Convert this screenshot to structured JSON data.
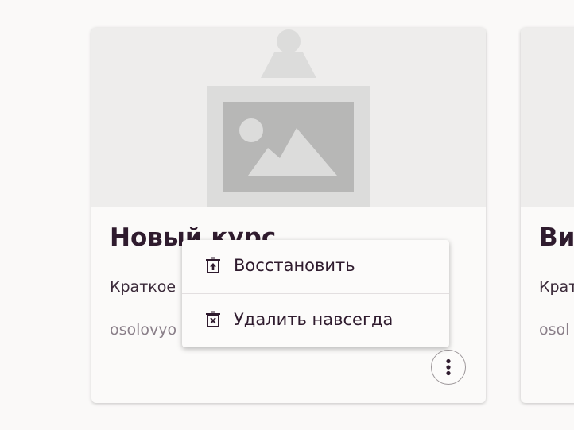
{
  "cards": [
    {
      "title": "Новый курс",
      "description": "Краткое",
      "author": "osolovyo"
    },
    {
      "title": "Ви",
      "description": "Крат",
      "author": "osol"
    }
  ],
  "context_menu": {
    "items": [
      {
        "label": "Восстановить",
        "icon": "restore-icon"
      },
      {
        "label": "Удалить навсегда",
        "icon": "delete-forever-icon"
      }
    ]
  },
  "colors": {
    "background": "#faf9f8",
    "card": "#fbfaf9",
    "thumbnail_bg": "#eeedec",
    "title_text": "#2f1b2e",
    "muted_text": "#8a7f89"
  }
}
